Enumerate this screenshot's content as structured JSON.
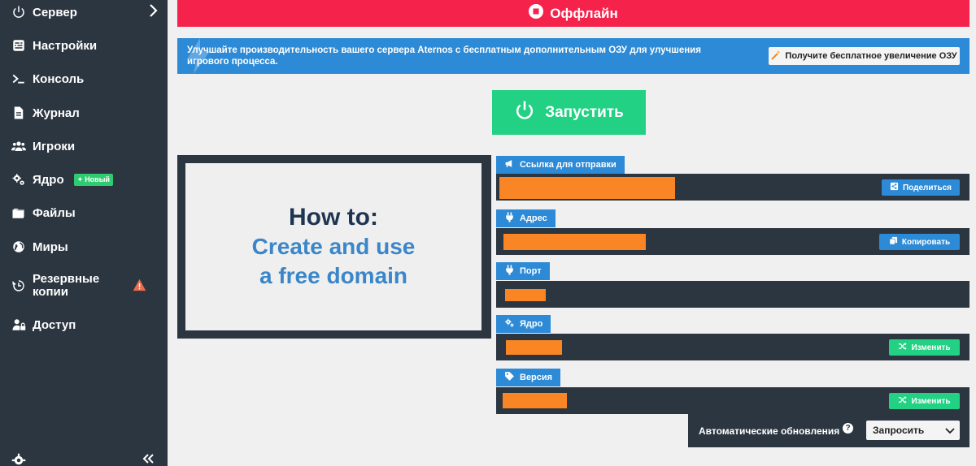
{
  "sidebar": {
    "items": [
      {
        "label": "Сервер",
        "icon": "power-icon"
      },
      {
        "label": "Настройки",
        "icon": "sliders-icon"
      },
      {
        "label": "Консоль",
        "icon": "terminal-icon"
      },
      {
        "label": "Журнал",
        "icon": "file-icon"
      },
      {
        "label": "Игроки",
        "icon": "users-icon"
      },
      {
        "label": "Ядро",
        "icon": "gears-icon",
        "badge": "Новый"
      },
      {
        "label": "Файлы",
        "icon": "folder-icon"
      },
      {
        "label": "Миры",
        "icon": "globe-icon"
      },
      {
        "label": "Резервные копии",
        "icon": "history-icon"
      },
      {
        "label": "Доступ",
        "icon": "user-lock-icon"
      }
    ]
  },
  "status": {
    "label": "Оффлайн",
    "color": "#f5224b"
  },
  "promo": {
    "text": "Улучшайте производительность вашего сервера Aternos с бесплатным дополнительным ОЗУ для улучшения игрового процесса.",
    "button": "Получите бесплатное увеличение ОЗУ"
  },
  "start": {
    "label": "Запустить",
    "color": "#22d184"
  },
  "video": {
    "line1": "How to:",
    "line2": "Create and use",
    "line3": "a free domain"
  },
  "panels": {
    "share": {
      "title": "Ссылка для отправки",
      "button": "Поделиться"
    },
    "address": {
      "title": "Адрес",
      "button": "Копировать"
    },
    "port": {
      "title": "Порт"
    },
    "software": {
      "title": "Ядро",
      "button": "Изменить"
    },
    "version": {
      "title": "Версия",
      "button": "Изменить"
    }
  },
  "auto_updates": {
    "label": "Автоматические обновления",
    "help": "?",
    "selected": "Запросить"
  },
  "colors": {
    "sidebar": "#2c3640",
    "accent_blue": "#2d8ad6",
    "redaction": "#f98524"
  }
}
